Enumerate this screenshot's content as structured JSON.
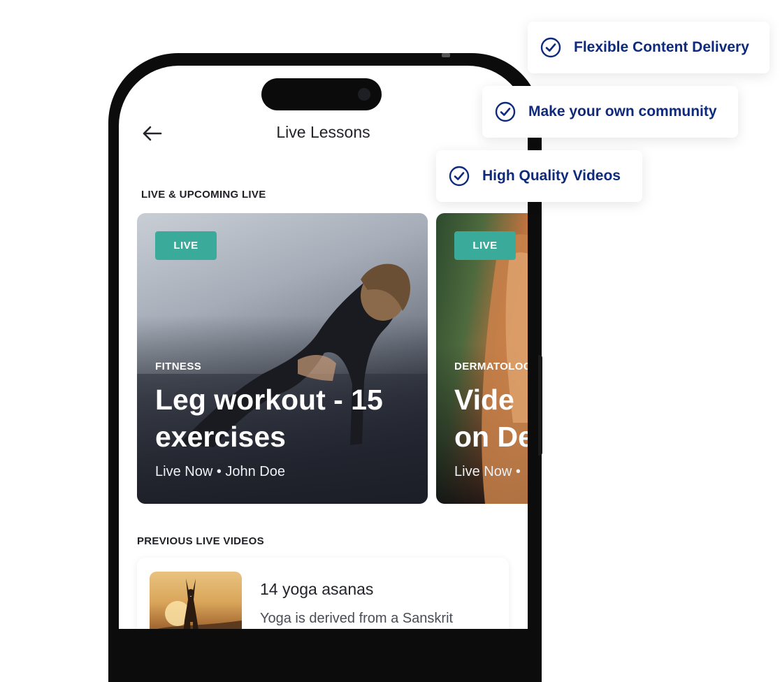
{
  "colors": {
    "brand_navy": "#0e2a7c",
    "live_badge": "#3aab9a",
    "text_dark": "#22242a"
  },
  "features": [
    {
      "label": "Flexible Content Delivery",
      "icon": "check-circle-icon"
    },
    {
      "label": "Make your own community",
      "icon": "check-circle-icon"
    },
    {
      "label": "High Quality Videos",
      "icon": "check-circle-icon"
    }
  ],
  "header": {
    "title": "Live Lessons",
    "back_icon": "arrow-left-icon"
  },
  "live_section": {
    "label": "LIVE & UPCOMING LIVE",
    "cards": [
      {
        "badge": "LIVE",
        "category": "FITNESS",
        "title_line1": "Leg workout - 15",
        "title_line2": "exercises",
        "meta": "Live Now • John Doe"
      },
      {
        "badge": "LIVE",
        "category": "DERMATOLOG",
        "title_line1": "Vide",
        "title_line2": "on De",
        "meta": "Live Now •"
      }
    ]
  },
  "previous_section": {
    "label": "PREVIOUS LIVE VIDEOS",
    "items": [
      {
        "title": "14 yoga asanas",
        "description": "Yoga is derived from a Sanskrit"
      }
    ]
  }
}
